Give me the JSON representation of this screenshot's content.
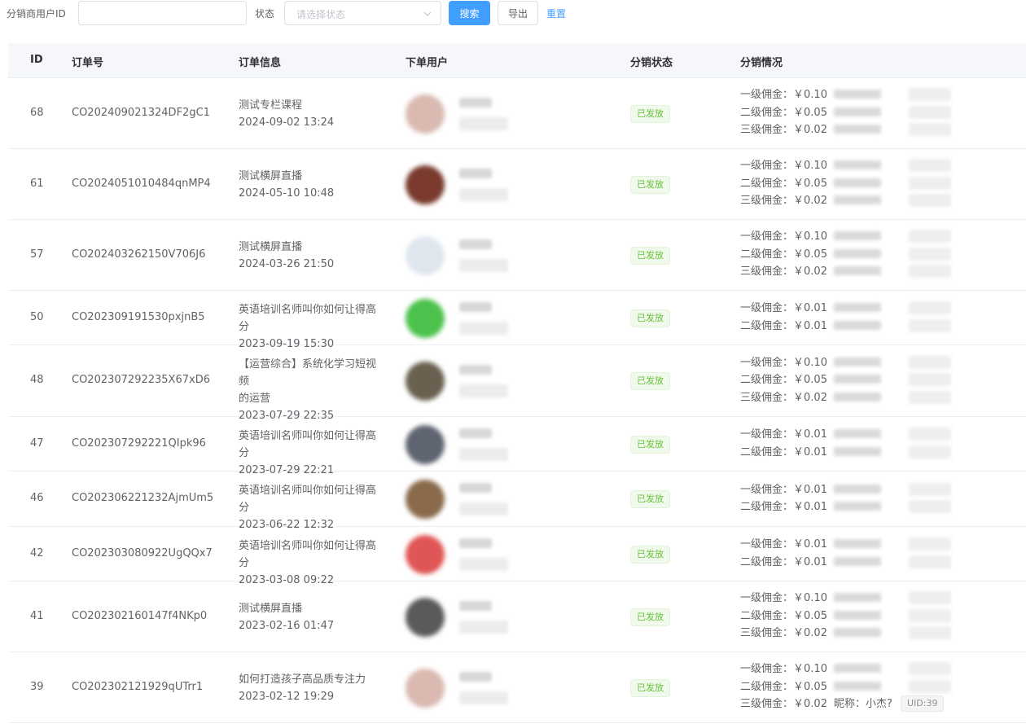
{
  "filter": {
    "uid_label": "分销商用户ID",
    "uid_value": "",
    "status_label": "状态",
    "status_placeholder": "请选择状态",
    "search_label": "搜索",
    "export_label": "导出",
    "reset_label": "重置"
  },
  "table": {
    "headers": {
      "id": "ID",
      "order_no": "订单号",
      "order_info": "订单信息",
      "user": "下单用户",
      "status": "分销状态",
      "commission": "分销情况"
    },
    "rows": [
      {
        "id": "68",
        "order_no": "CO202409021324DF2gC1",
        "info_lines": [
          "测试专栏课程"
        ],
        "time": "2024-09-02 13:24",
        "status": "已发放",
        "avatar_color": "#d9b9b0",
        "commissions": [
          {
            "label": "一级佣金：",
            "amount": "￥0.10"
          },
          {
            "label": "二级佣金：",
            "amount": "￥0.05"
          },
          {
            "label": "三级佣金：",
            "amount": "￥0.02"
          }
        ]
      },
      {
        "id": "61",
        "order_no": "CO2024051010484qnMP4",
        "info_lines": [
          "测试横屏直播"
        ],
        "time": "2024-05-10 10:48",
        "status": "已发放",
        "avatar_color": "#7a3b2e",
        "commissions": [
          {
            "label": "一级佣金：",
            "amount": "￥0.10"
          },
          {
            "label": "二级佣金：",
            "amount": "￥0.05"
          },
          {
            "label": "三级佣金：",
            "amount": "￥0.02"
          }
        ]
      },
      {
        "id": "57",
        "order_no": "CO202403262150V706J6",
        "info_lines": [
          "测试横屏直播"
        ],
        "time": "2024-03-26 21:50",
        "status": "已发放",
        "avatar_color": "#dfe6ee",
        "commissions": [
          {
            "label": "一级佣金：",
            "amount": "￥0.10"
          },
          {
            "label": "二级佣金：",
            "amount": "￥0.05"
          },
          {
            "label": "三级佣金：",
            "amount": "￥0.02"
          }
        ]
      },
      {
        "id": "50",
        "order_no": "CO202309191530pxjnB5",
        "info_lines": [
          "英语培训名师叫你如何让得高分"
        ],
        "time": "2023-09-19 15:30",
        "status": "已发放",
        "avatar_color": "#4cc24c",
        "commissions": [
          {
            "label": "一级佣金：",
            "amount": "￥0.01"
          },
          {
            "label": "二级佣金：",
            "amount": "￥0.01"
          }
        ]
      },
      {
        "id": "48",
        "order_no": "CO202307292235X67xD6",
        "info_lines": [
          "【运营综合】系统化学习短视频",
          "的运营"
        ],
        "time": "2023-07-29 22:35",
        "status": "已发放",
        "avatar_color": "#6a6050",
        "commissions": [
          {
            "label": "一级佣金：",
            "amount": "￥0.10"
          },
          {
            "label": "二级佣金：",
            "amount": "￥0.05"
          },
          {
            "label": "三级佣金：",
            "amount": "￥0.02"
          }
        ]
      },
      {
        "id": "47",
        "order_no": "CO202307292221QIpk96",
        "info_lines": [
          "英语培训名师叫你如何让得高分"
        ],
        "time": "2023-07-29 22:21",
        "status": "已发放",
        "avatar_color": "#5e6470",
        "commissions": [
          {
            "label": "一级佣金：",
            "amount": "￥0.01"
          },
          {
            "label": "二级佣金：",
            "amount": "￥0.01"
          }
        ]
      },
      {
        "id": "46",
        "order_no": "CO202306221232AjmUm5",
        "info_lines": [
          "英语培训名师叫你如何让得高分"
        ],
        "time": "2023-06-22 12:32",
        "status": "已发放",
        "avatar_color": "#8a6a4a",
        "commissions": [
          {
            "label": "一级佣金：",
            "amount": "￥0.01"
          },
          {
            "label": "二级佣金：",
            "amount": "￥0.01"
          }
        ]
      },
      {
        "id": "42",
        "order_no": "CO202303080922UgQQx7",
        "info_lines": [
          "英语培训名师叫你如何让得高分"
        ],
        "time": "2023-03-08 09:22",
        "status": "已发放",
        "avatar_color": "#e05555",
        "commissions": [
          {
            "label": "一级佣金：",
            "amount": "￥0.01"
          },
          {
            "label": "二级佣金：",
            "amount": "￥0.01"
          }
        ]
      },
      {
        "id": "41",
        "order_no": "CO202302160147f4NKp0",
        "info_lines": [
          "测试横屏直播"
        ],
        "time": "2023-02-16 01:47",
        "status": "已发放",
        "avatar_color": "#5a5a5a",
        "commissions": [
          {
            "label": "一级佣金：",
            "amount": "￥0.10"
          },
          {
            "label": "二级佣金：",
            "amount": "￥0.05"
          },
          {
            "label": "三级佣金：",
            "amount": "￥0.02"
          }
        ]
      },
      {
        "id": "39",
        "order_no": "CO202302121929qUTrr1",
        "info_lines": [
          "如何打造孩子高品质专注力"
        ],
        "time": "2023-02-12 19:29",
        "status": "已发放",
        "avatar_color": "#d9b9b0",
        "commissions": [
          {
            "label": "一级佣金：",
            "amount": "￥0.10"
          },
          {
            "label": "二级佣金：",
            "amount": "￥0.05"
          },
          {
            "label": "三级佣金：",
            "amount": "￥0.02",
            "nickname": "昵称：小杰?",
            "uid": "UID:39"
          }
        ]
      }
    ]
  }
}
